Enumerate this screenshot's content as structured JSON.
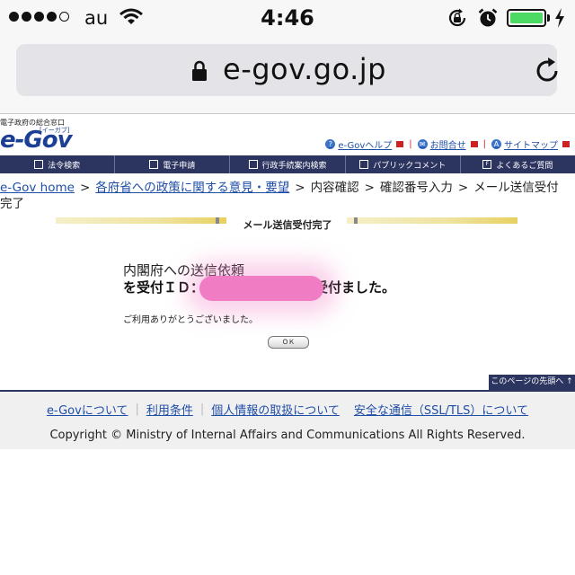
{
  "status_bar": {
    "carrier": "au",
    "time": "4:46",
    "battery_color": "#4cd964"
  },
  "browser": {
    "url": "e-gov.go.jp"
  },
  "header": {
    "tagline": "電子政府の総合窓口",
    "logo_text": "e-Gov",
    "logo_ruby": "[イーガブ]",
    "links": [
      {
        "label": "e-Govヘルプ",
        "icon": "help-icon"
      },
      {
        "label": "お問合せ",
        "icon": "mail-icon"
      },
      {
        "label": "サイトマップ",
        "icon": "sitemap-icon"
      }
    ]
  },
  "nav": {
    "items": [
      {
        "label": "法令検索",
        "icon": "book-icon"
      },
      {
        "label": "電子申請",
        "icon": "pen-icon"
      },
      {
        "label": "行政手続案内検索",
        "icon": "search-icon"
      },
      {
        "label": "パブリックコメント",
        "icon": "comment-icon"
      },
      {
        "label": "よくあるご質問",
        "icon": "faq-icon"
      }
    ],
    "bar_color": "#2c3560"
  },
  "breadcrumb": {
    "home": "e-Gov home",
    "link2": "各府省への政策に関する意見・要望",
    "step3": "内容確認",
    "step4": "確認番号入力",
    "step5": "メール送信受付完了",
    "separator": ">"
  },
  "content": {
    "heading": "メール送信受付完了",
    "message_line1": "内閣府への送信依頼",
    "message_line2_prefix": "を受付ＩＤ：",
    "message_line2_suffix": "受付ました。",
    "thanks": "ご利用ありがとうございました。",
    "ok_label": "ＯＫ"
  },
  "pagetop": {
    "label": "このページの先頭へ"
  },
  "footer": {
    "links": [
      "e-Govについて",
      "利用条件",
      "個人情報の取扱について",
      "安全な通信（SSL/TLS）について"
    ],
    "copyright": "Copyright © Ministry of Internal Affairs and Communications All Rights Reserved."
  }
}
